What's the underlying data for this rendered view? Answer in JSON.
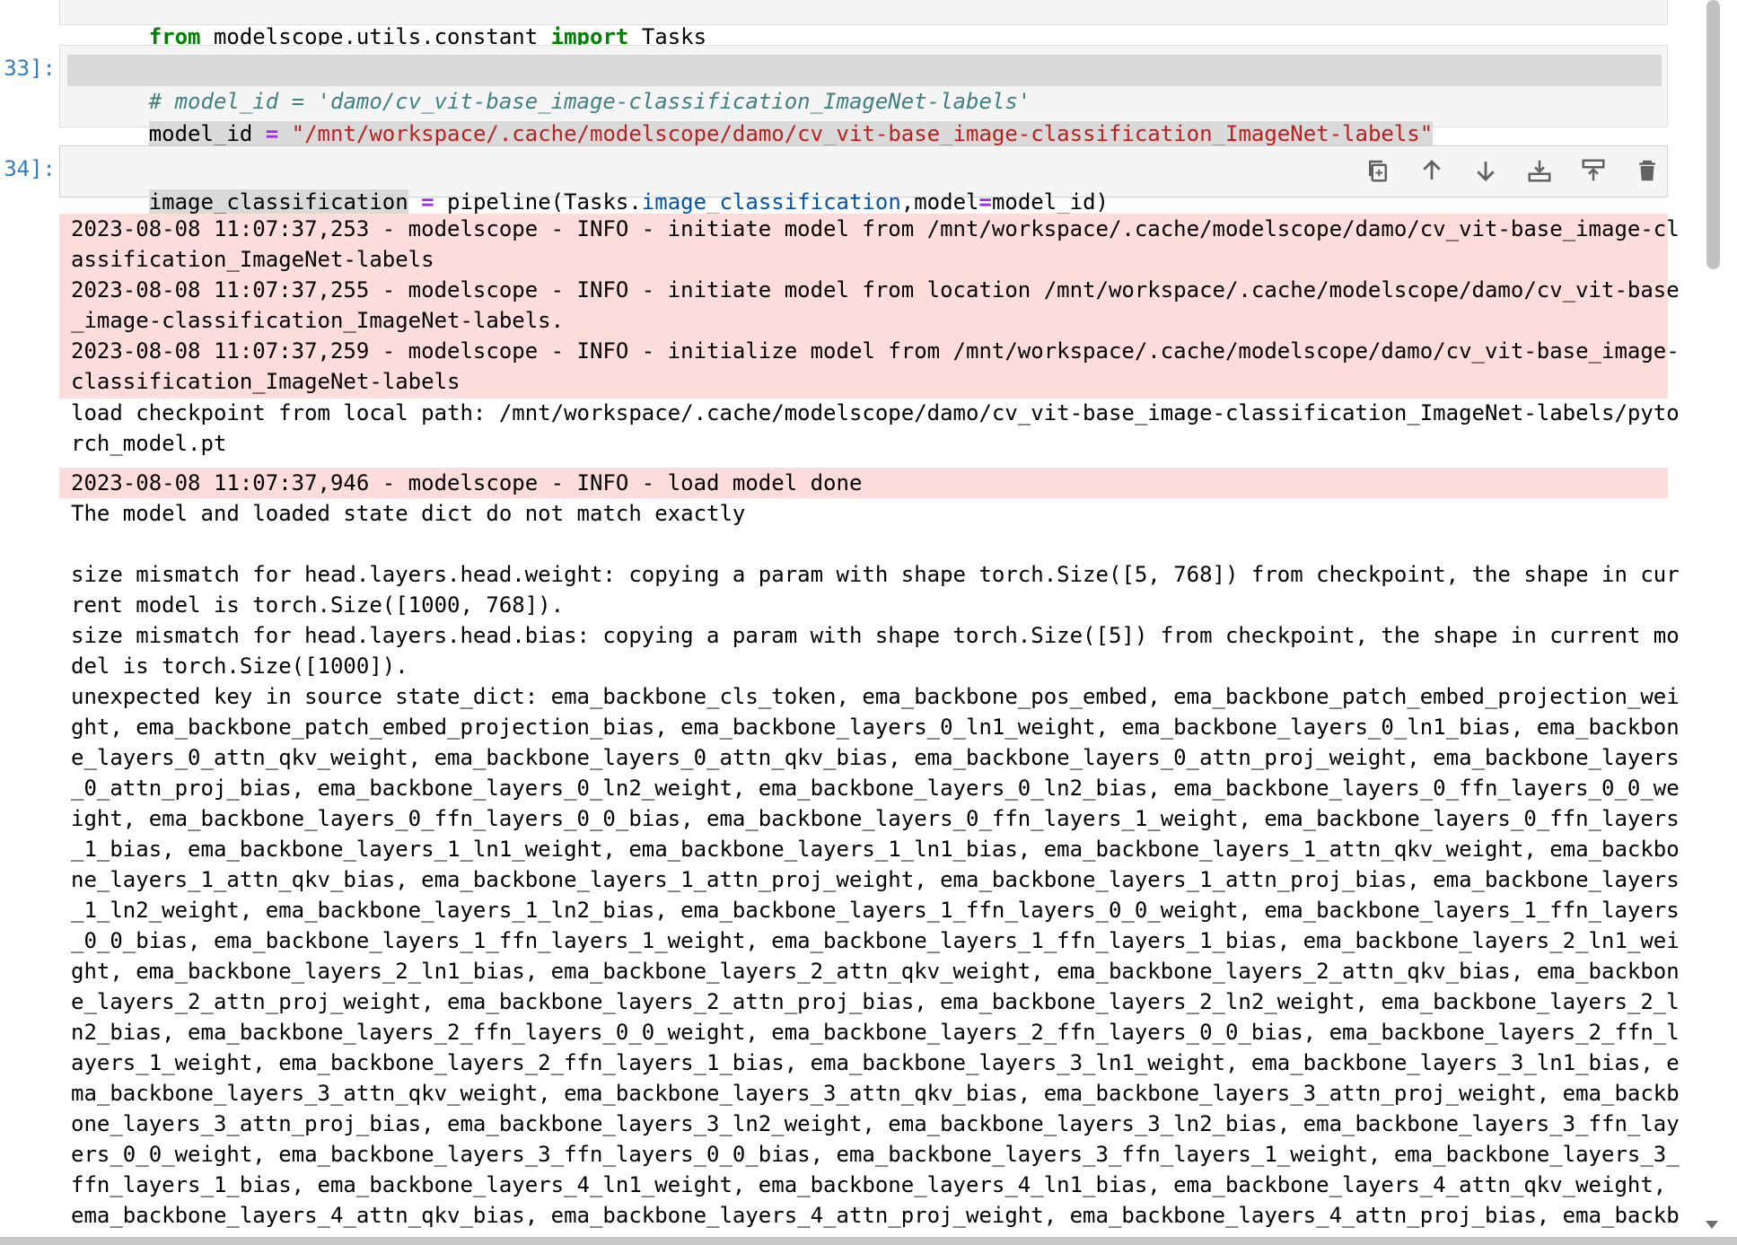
{
  "cells": {
    "top_fragment": {
      "line": "from modelscope.utils.constant import Tasks"
    },
    "cell33": {
      "prompt": "33]:",
      "comment": "# model_id = 'damo/cv_vit-base_image-classification_ImageNet-labels'",
      "var": "model_id",
      "op": "=",
      "string": "\"/mnt/workspace/.cache/modelscope/damo/cv_vit-base_image-classification_ImageNet-labels\""
    },
    "cell34": {
      "prompt": "34]:",
      "var": "image_classification",
      "op": "=",
      "call_a": "pipeline(Tasks.",
      "call_b": "image_classification",
      "call_c": ",model",
      "call_op": "=",
      "call_d": "model_id)"
    }
  },
  "toolbar": {
    "icons": [
      "copy-icon",
      "move-up-icon",
      "move-down-icon",
      "insert-below-icon",
      "insert-above-icon",
      "delete-icon"
    ]
  },
  "output": {
    "log1": [
      "2023-08-08 11:07:37,253 - modelscope - INFO - initiate model from /mnt/workspace/.cache/modelscope/damo/cv_vit-base_image-cl",
      "assification_ImageNet-labels",
      "2023-08-08 11:07:37,255 - modelscope - INFO - initiate model from location /mnt/workspace/.cache/modelscope/damo/cv_vit-base",
      "_image-classification_ImageNet-labels.",
      "2023-08-08 11:07:37,259 - modelscope - INFO - initialize model from /mnt/workspace/.cache/modelscope/damo/cv_vit-base_image-",
      "classification_ImageNet-labels"
    ],
    "plain1": [
      "load checkpoint from local path: /mnt/workspace/.cache/modelscope/damo/cv_vit-base_image-classification_ImageNet-labels/pyto",
      "rch_model.pt"
    ],
    "log2": [
      "2023-08-08 11:07:37,946 - modelscope - INFO - load model done"
    ],
    "plain2": [
      "The model and loaded state dict do not match exactly",
      "",
      "size mismatch for head.layers.head.weight: copying a param with shape torch.Size([5, 768]) from checkpoint, the shape in cur",
      "rent model is torch.Size([1000, 768]).",
      "size mismatch for head.layers.head.bias: copying a param with shape torch.Size([5]) from checkpoint, the shape in current mo",
      "del is torch.Size([1000]).",
      "unexpected key in source state_dict: ema_backbone_cls_token, ema_backbone_pos_embed, ema_backbone_patch_embed_projection_wei",
      "ght, ema_backbone_patch_embed_projection_bias, ema_backbone_layers_0_ln1_weight, ema_backbone_layers_0_ln1_bias, ema_backbon",
      "e_layers_0_attn_qkv_weight, ema_backbone_layers_0_attn_qkv_bias, ema_backbone_layers_0_attn_proj_weight, ema_backbone_layers",
      "_0_attn_proj_bias, ema_backbone_layers_0_ln2_weight, ema_backbone_layers_0_ln2_bias, ema_backbone_layers_0_ffn_layers_0_0_we",
      "ight, ema_backbone_layers_0_ffn_layers_0_0_bias, ema_backbone_layers_0_ffn_layers_1_weight, ema_backbone_layers_0_ffn_layers",
      "_1_bias, ema_backbone_layers_1_ln1_weight, ema_backbone_layers_1_ln1_bias, ema_backbone_layers_1_attn_qkv_weight, ema_backbo",
      "ne_layers_1_attn_qkv_bias, ema_backbone_layers_1_attn_proj_weight, ema_backbone_layers_1_attn_proj_bias, ema_backbone_layers",
      "_1_ln2_weight, ema_backbone_layers_1_ln2_bias, ema_backbone_layers_1_ffn_layers_0_0_weight, ema_backbone_layers_1_ffn_layers",
      "_0_0_bias, ema_backbone_layers_1_ffn_layers_1_weight, ema_backbone_layers_1_ffn_layers_1_bias, ema_backbone_layers_2_ln1_wei",
      "ght, ema_backbone_layers_2_ln1_bias, ema_backbone_layers_2_attn_qkv_weight, ema_backbone_layers_2_attn_qkv_bias, ema_backbon",
      "e_layers_2_attn_proj_weight, ema_backbone_layers_2_attn_proj_bias, ema_backbone_layers_2_ln2_weight, ema_backbone_layers_2_l",
      "n2_bias, ema_backbone_layers_2_ffn_layers_0_0_weight, ema_backbone_layers_2_ffn_layers_0_0_bias, ema_backbone_layers_2_ffn_l",
      "ayers_1_weight, ema_backbone_layers_2_ffn_layers_1_bias, ema_backbone_layers_3_ln1_weight, ema_backbone_layers_3_ln1_bias, e",
      "ma_backbone_layers_3_attn_qkv_weight, ema_backbone_layers_3_attn_qkv_bias, ema_backbone_layers_3_attn_proj_weight, ema_backb",
      "one_layers_3_attn_proj_bias, ema_backbone_layers_3_ln2_weight, ema_backbone_layers_3_ln2_bias, ema_backbone_layers_3_ffn_lay",
      "ers_0_0_weight, ema_backbone_layers_3_ffn_layers_0_0_bias, ema_backbone_layers_3_ffn_layers_1_weight, ema_backbone_layers_3_",
      "ffn_layers_1_bias, ema_backbone_layers_4_ln1_weight, ema_backbone_layers_4_ln1_bias, ema_backbone_layers_4_attn_qkv_weight,",
      "ema_backbone_layers_4_attn_qkv_bias, ema_backbone_layers_4_attn_proj_weight, ema_backbone_layers_4_attn_proj_bias, ema_backb"
    ]
  },
  "colors": {
    "error_bg": "#fddcdc",
    "prompt": "#307fc1",
    "string": "#ba2121",
    "comment": "#408080",
    "keyword": "#008000"
  }
}
